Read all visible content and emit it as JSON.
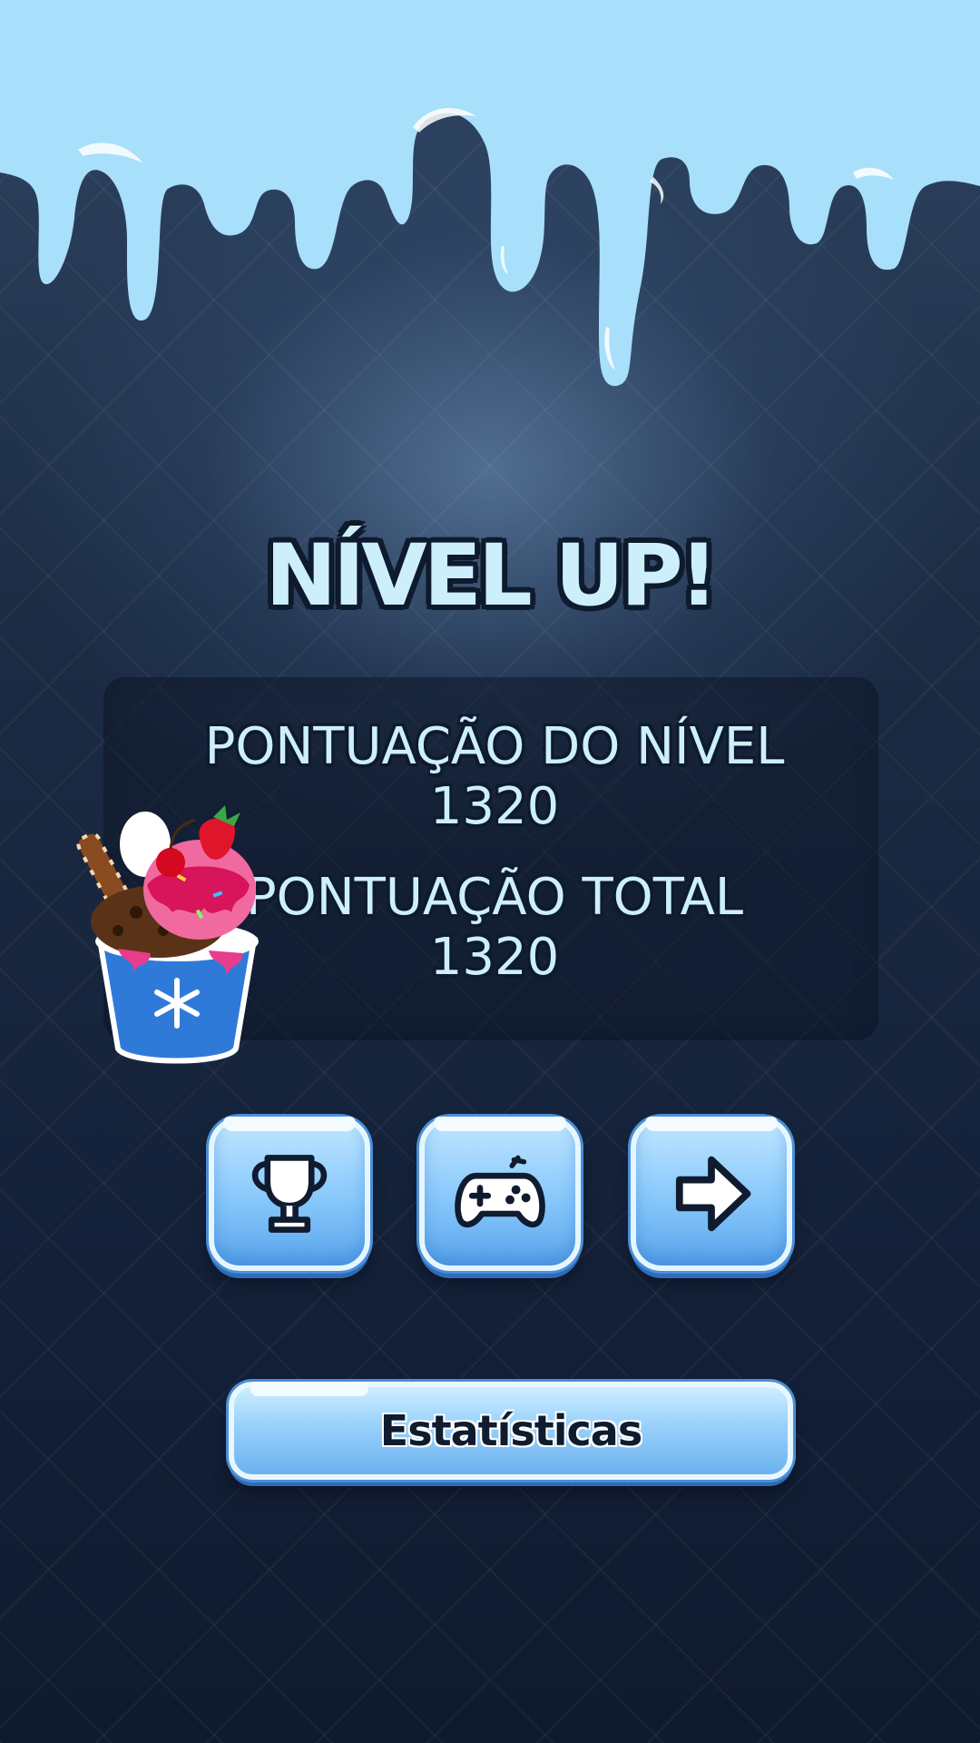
{
  "title": "NÍVEL UP!",
  "scores": {
    "level_score_label": "PONTUAÇÃO DO NÍVEL 1320",
    "total_score_label": "PONTUAÇÃO TOTAL 1320"
  },
  "actions": {
    "trophy_icon": "trophy-icon",
    "gamepad_icon": "gamepad-icon",
    "next_icon": "arrow-right-icon",
    "stats_label": "Estatísticas"
  },
  "colors": {
    "background": "#1c2c44",
    "drip": "#a8dffb",
    "title_text": "#cdeffc",
    "button": "#86c7fb"
  }
}
